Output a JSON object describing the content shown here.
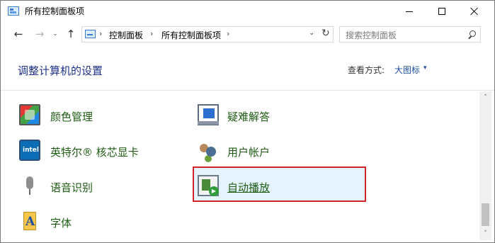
{
  "window": {
    "title": "所有控制面板项",
    "minimize_icon": "minimize-icon",
    "maximize_icon": "maximize-icon",
    "close_icon": "close-icon"
  },
  "nav": {
    "back": "←",
    "forward": "→",
    "recent": "⌄",
    "up": "↑",
    "breadcrumb": [
      "控制面板",
      "所有控制面板项"
    ],
    "separator": "›",
    "dropdown": "⌄",
    "refresh": "↻"
  },
  "search": {
    "placeholder": "搜索控制面板"
  },
  "header": {
    "title": "调整计算机的设置",
    "view_by_label": "查看方式:",
    "view_by_value": "大图标",
    "view_by_caret": "▾"
  },
  "items": [
    {
      "label": "颜色管理",
      "icon": "color-management-icon"
    },
    {
      "label": "疑难解答",
      "icon": "troubleshooting-icon"
    },
    {
      "label": "英特尔® 核芯显卡",
      "icon": "intel-graphics-icon"
    },
    {
      "label": "用户帐户",
      "icon": "user-accounts-icon"
    },
    {
      "label": "语音识别",
      "icon": "microphone-icon"
    },
    {
      "label": "自动播放",
      "icon": "autoplay-icon",
      "selected": true
    },
    {
      "label": "字体",
      "icon": "fonts-icon"
    }
  ],
  "scrollbar": {
    "up": "˄",
    "down": "˅"
  },
  "colors": {
    "item_text": "#1e5c12",
    "title_text": "#1e3287",
    "link": "#1e50a2",
    "highlight_border": "#d2232a"
  }
}
